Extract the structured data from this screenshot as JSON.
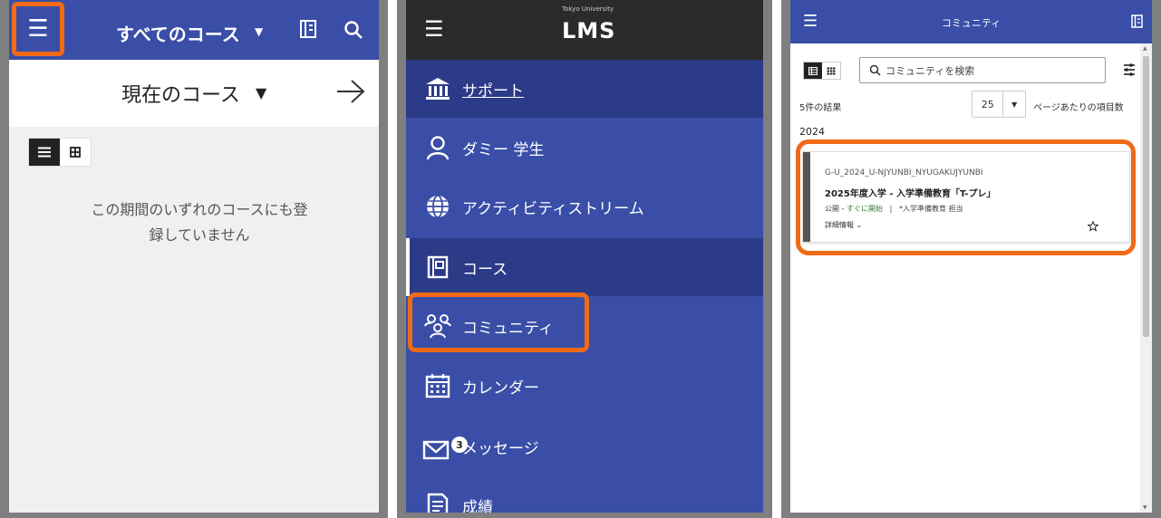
{
  "panel1": {
    "header_title": "すべてのコース",
    "current_courses_label": "現在のコース",
    "empty_message_line1": "この期間のいずれのコースにも登",
    "empty_message_line2": "録していません"
  },
  "panel2": {
    "logo_small": "Tokyo University",
    "logo": "LMS",
    "menu": [
      {
        "label": "サポート",
        "icon": "institution-icon"
      },
      {
        "label": "ダミー 学生",
        "icon": "user-icon"
      },
      {
        "label": "アクティビティストリーム",
        "icon": "globe-icon"
      },
      {
        "label": "コース",
        "icon": "course-book-icon"
      },
      {
        "label": "コミュニティ",
        "icon": "community-icon"
      },
      {
        "label": "カレンダー",
        "icon": "calendar-icon"
      },
      {
        "label": "メッセージ",
        "icon": "message-icon",
        "badge": "3"
      },
      {
        "label": "成績",
        "icon": "grades-icon"
      }
    ]
  },
  "panel3": {
    "header_title": "コミュニティ",
    "search_placeholder": "コミュニティを検索",
    "results_count": "5件の結果",
    "page_size": "25",
    "per_page_label": "ページあたりの項目数",
    "year": "2024",
    "card": {
      "id": "G-U_2024_U-NJYUNBI_NYUGAKUJYUNBI",
      "name": "2025年度入学 - 入学準備教育「T-プレ」",
      "status": "公開",
      "separator": " - ",
      "open_text": "すぐに開始",
      "pipe": "|",
      "instructor": "*入学準備教育 担当",
      "detail_label": "詳細情報"
    }
  },
  "colors": {
    "header_blue": "#3a4ea7",
    "menu_dark": "#2c3b87",
    "highlight_orange": "#f06a17",
    "open_green": "#2e7d32"
  }
}
